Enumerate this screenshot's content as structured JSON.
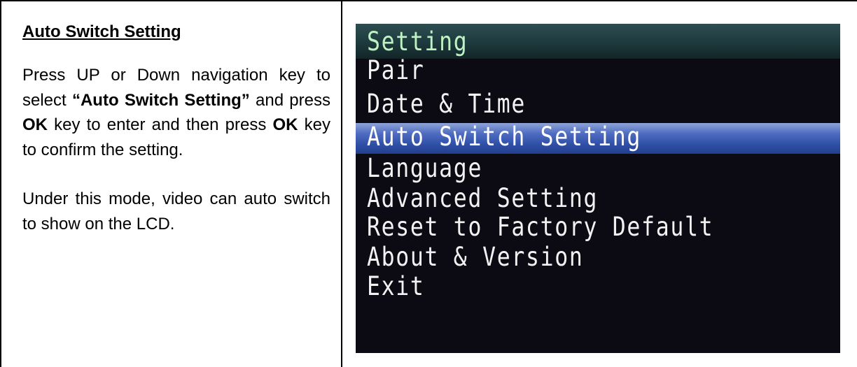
{
  "instructions": {
    "heading": "Auto Switch Setting",
    "paragraph1": {
      "part1": "Press UP or Down navigation key to select ",
      "highlight": "“Auto Switch Setting”",
      "part2": " and press ",
      "ok_1": "OK",
      "part3": " key to enter and then press ",
      "ok_2": "OK",
      "part4": " key to confirm the setting."
    },
    "paragraph2": "Under this mode, video can auto switch to show on the LCD."
  },
  "menu_screen": {
    "title": "Setting",
    "items": [
      "Pair",
      "Date & Time",
      "Auto Switch Setting",
      "Language",
      "Advanced Setting",
      "Reset to Factory Default",
      "About & Version",
      "Exit"
    ],
    "selected_item": "Auto Switch Setting",
    "colors": {
      "screen_background": "#0c0b14",
      "title_bar": "#1d3a3d",
      "title_text": "#bff2c2",
      "item_text": "#f2f2f2",
      "selection_highlight": "#3a59b3"
    }
  }
}
